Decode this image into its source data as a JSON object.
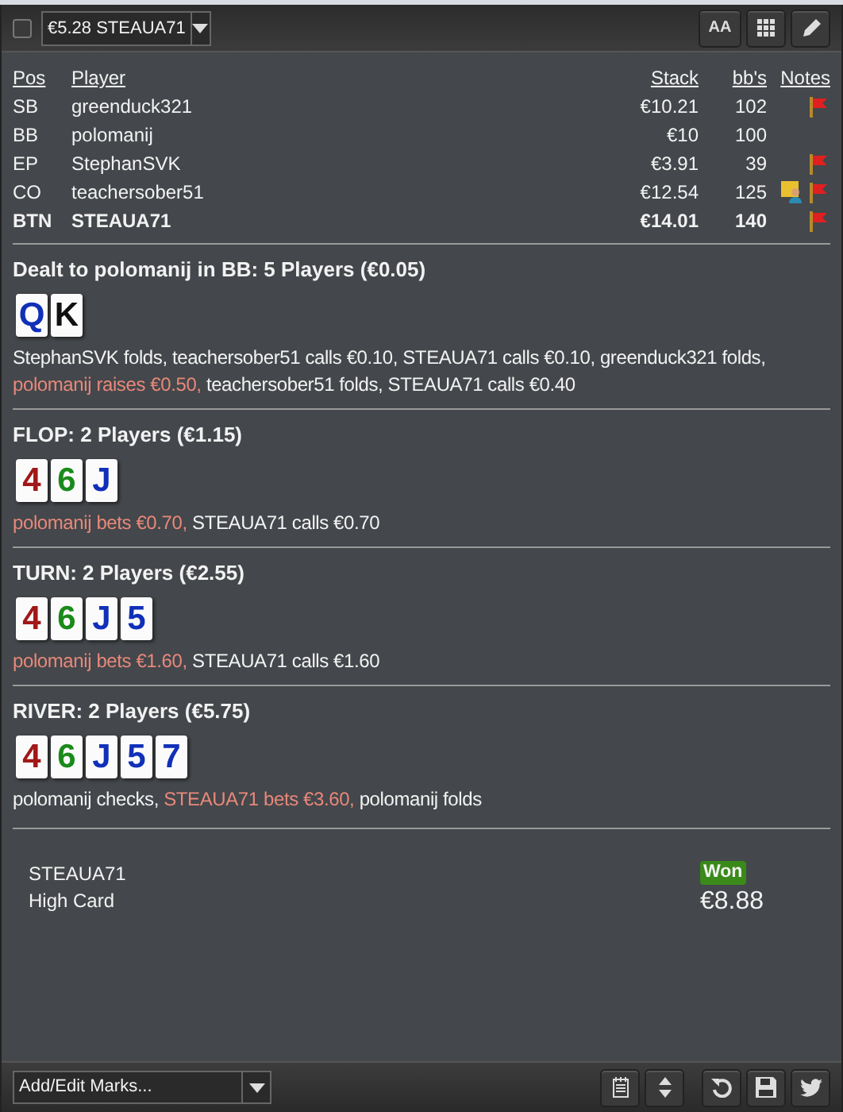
{
  "toolbar": {
    "checkbox": {
      "checked": false
    },
    "hand_select": {
      "value": "€5.28 STEAUA71"
    },
    "font_button": {
      "label": "AA"
    }
  },
  "players": {
    "columns": [
      "Pos",
      "Player",
      "Stack",
      "bb's",
      "Notes"
    ],
    "rows": [
      {
        "pos": "SB",
        "player": "greenduck321",
        "stack": "€10.21",
        "bbs": "102",
        "note": false,
        "flag": true,
        "hero": false
      },
      {
        "pos": "BB",
        "player": "polomanij",
        "stack": "€10",
        "bbs": "100",
        "note": false,
        "flag": false,
        "hero": false
      },
      {
        "pos": "EP",
        "player": "StephanSVK",
        "stack": "€3.91",
        "bbs": "39",
        "note": false,
        "flag": true,
        "hero": false
      },
      {
        "pos": "CO",
        "player": "teachersober51",
        "stack": "€12.54",
        "bbs": "125",
        "note": true,
        "flag": true,
        "hero": false
      },
      {
        "pos": "BTN",
        "player": "STEAUA71",
        "stack": "€14.01",
        "bbs": "140",
        "note": false,
        "flag": true,
        "hero": true
      }
    ]
  },
  "streets": [
    {
      "title": "Dealt to polomanij in BB: 5 Players (€0.05)",
      "cards": [
        {
          "rank": "Q",
          "color": "#1030b8"
        },
        {
          "rank": "K",
          "color": "#111111"
        }
      ],
      "actions": [
        {
          "text": "StephanSVK folds, teachersober51 calls €0.10, STEAUA71 calls €0.10, greenduck321 folds,",
          "highlight": false
        },
        {
          "text": "polomanij raises €0.50,",
          "highlight": true
        },
        {
          "text": "teachersober51 folds, STEAUA71 calls €0.40",
          "highlight": false
        }
      ]
    },
    {
      "title": "FLOP: 2 Players (€1.15)",
      "cards": [
        {
          "rank": "4",
          "color": "#a01818"
        },
        {
          "rank": "6",
          "color": "#1a8a1a"
        },
        {
          "rank": "J",
          "color": "#1030b8"
        }
      ],
      "actions": [
        {
          "text": "polomanij bets €0.70,",
          "highlight": true
        },
        {
          "text": "STEAUA71 calls €0.70",
          "highlight": false
        }
      ]
    },
    {
      "title": "TURN: 2 Players (€2.55)",
      "cards": [
        {
          "rank": "4",
          "color": "#a01818"
        },
        {
          "rank": "6",
          "color": "#1a8a1a"
        },
        {
          "rank": "J",
          "color": "#1030b8"
        },
        {
          "rank": "5",
          "color": "#1030b8"
        }
      ],
      "actions": [
        {
          "text": "polomanij bets €1.60,",
          "highlight": true
        },
        {
          "text": "STEAUA71 calls €1.60",
          "highlight": false
        }
      ]
    },
    {
      "title": "RIVER: 2 Players (€5.75)",
      "cards": [
        {
          "rank": "4",
          "color": "#a01818"
        },
        {
          "rank": "6",
          "color": "#1a8a1a"
        },
        {
          "rank": "J",
          "color": "#1030b8"
        },
        {
          "rank": "5",
          "color": "#1030b8"
        },
        {
          "rank": "7",
          "color": "#1030b8"
        }
      ],
      "actions": [
        {
          "text": "polomanij checks,",
          "highlight": false
        },
        {
          "text": "STEAUA71 bets €3.60,",
          "highlight": true
        },
        {
          "text": "polomanij folds",
          "highlight": false
        }
      ]
    }
  ],
  "result": {
    "player": "STEAUA71",
    "hand": "High Card",
    "badge": "Won",
    "amount": "€8.88"
  },
  "bottom_bar": {
    "marks_select": {
      "value": "Add/Edit Marks..."
    }
  }
}
